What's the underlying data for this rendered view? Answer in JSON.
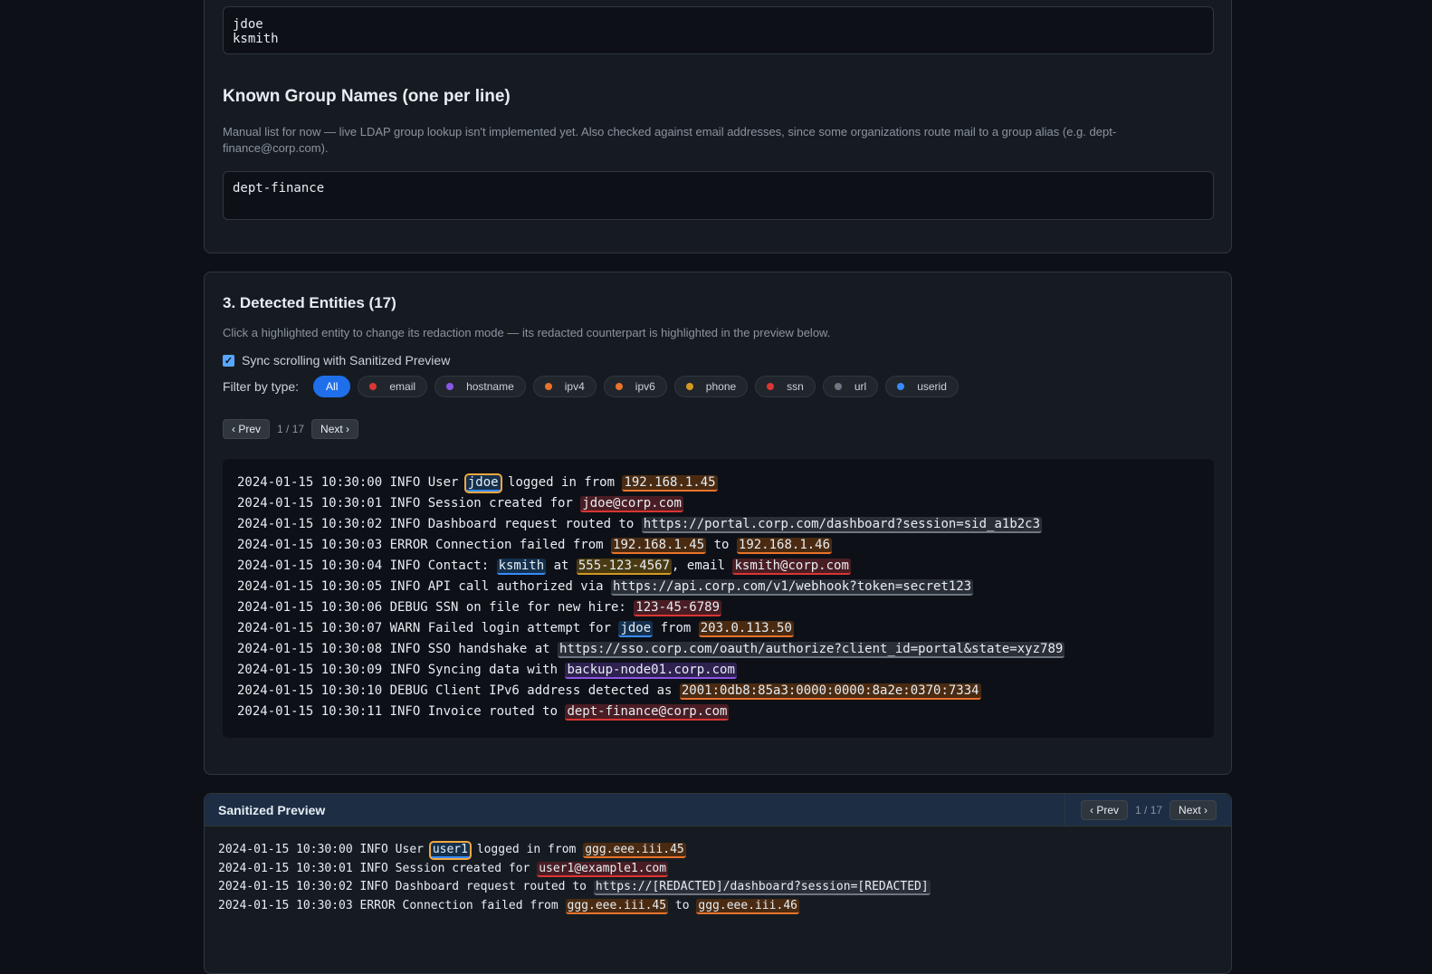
{
  "usernames": {
    "value": "jdoe\nksmith"
  },
  "groups": {
    "heading": "Known Group Names (one per line)",
    "help": "Manual list for now — live LDAP group lookup isn't implemented yet. Also checked against email addresses, since some organizations route mail to a group alias (e.g. dept-finance@corp.com).",
    "value": "dept-finance"
  },
  "entities": {
    "heading": "3. Detected Entities (17)",
    "help": "Click a highlighted entity to change its redaction mode — its redacted counterpart is highlighted in the preview below.",
    "sync_label": "Sync scrolling with Sanitized Preview",
    "sync_checked": true,
    "filter_label": "Filter by type:",
    "filters": [
      {
        "label": "All",
        "active": true
      },
      {
        "label": "email",
        "color": "#da3633"
      },
      {
        "label": "hostname",
        "color": "#8957e5"
      },
      {
        "label": "ipv4",
        "color": "#e8732a"
      },
      {
        "label": "ipv6",
        "color": "#e8732a"
      },
      {
        "label": "phone",
        "color": "#d29922"
      },
      {
        "label": "ssn",
        "color": "#da3633"
      },
      {
        "label": "url",
        "color": "#6e7681"
      },
      {
        "label": "userid",
        "color": "#388bfd"
      }
    ],
    "prev_label": "‹ Prev",
    "next_label": "Next ›",
    "counter": "1 / 17",
    "log_lines": [
      [
        {
          "t": "2024-01-15 10:30:00 INFO User "
        },
        {
          "t": "jdoe",
          "type": "userid",
          "selected": true
        },
        {
          "t": " logged in from "
        },
        {
          "t": "192.168.1.45",
          "type": "ipv4"
        }
      ],
      [
        {
          "t": "2024-01-15 10:30:01 INFO Session created for "
        },
        {
          "t": "jdoe@corp.com",
          "type": "email"
        }
      ],
      [
        {
          "t": "2024-01-15 10:30:02 INFO Dashboard request routed to "
        },
        {
          "t": "https://portal.corp.com/dashboard?session=sid_a1b2c3",
          "type": "url"
        }
      ],
      [
        {
          "t": "2024-01-15 10:30:03 ERROR Connection failed from "
        },
        {
          "t": "192.168.1.45",
          "type": "ipv4"
        },
        {
          "t": " to "
        },
        {
          "t": "192.168.1.46",
          "type": "ipv4"
        }
      ],
      [
        {
          "t": "2024-01-15 10:30:04 INFO Contact: "
        },
        {
          "t": "ksmith",
          "type": "userid"
        },
        {
          "t": " at "
        },
        {
          "t": "555-123-4567",
          "type": "phone"
        },
        {
          "t": ", email "
        },
        {
          "t": "ksmith@corp.com",
          "type": "email"
        }
      ],
      [
        {
          "t": "2024-01-15 10:30:05 INFO API call authorized via "
        },
        {
          "t": "https://api.corp.com/v1/webhook?token=secret123",
          "type": "url"
        }
      ],
      [
        {
          "t": "2024-01-15 10:30:06 DEBUG SSN on file for new hire: "
        },
        {
          "t": "123-45-6789",
          "type": "ssn"
        }
      ],
      [
        {
          "t": "2024-01-15 10:30:07 WARN Failed login attempt for "
        },
        {
          "t": "jdoe",
          "type": "userid"
        },
        {
          "t": " from "
        },
        {
          "t": "203.0.113.50",
          "type": "ipv4"
        }
      ],
      [
        {
          "t": "2024-01-15 10:30:08 INFO SSO handshake at "
        },
        {
          "t": "https://sso.corp.com/oauth/authorize?client_id=portal&state=xyz789",
          "type": "url"
        }
      ],
      [
        {
          "t": "2024-01-15 10:30:09 INFO Syncing data with "
        },
        {
          "t": "backup-node01.corp.com",
          "type": "hostname"
        }
      ],
      [
        {
          "t": "2024-01-15 10:30:10 DEBUG Client IPv6 address detected as "
        },
        {
          "t": "2001:0db8:85a3:0000:0000:8a2e:0370:7334",
          "type": "ipv6"
        }
      ],
      [
        {
          "t": "2024-01-15 10:30:11 INFO Invoice routed to "
        },
        {
          "t": "dept-finance@corp.com",
          "type": "email"
        }
      ]
    ]
  },
  "preview": {
    "title": "Sanitized Preview",
    "prev_label": "‹ Prev",
    "next_label": "Next ›",
    "counter": "1 / 17",
    "lines": [
      [
        {
          "t": "2024-01-15 10:30:00 INFO User "
        },
        {
          "t": "user1",
          "type": "userid",
          "selected": true
        },
        {
          "t": " logged in from "
        },
        {
          "t": "ggg.eee.iii.45",
          "type": "ipv4"
        }
      ],
      [
        {
          "t": "2024-01-15 10:30:01 INFO Session created for "
        },
        {
          "t": "user1@example1.com",
          "type": "email"
        }
      ],
      [
        {
          "t": "2024-01-15 10:30:02 INFO Dashboard request routed to "
        },
        {
          "t": "https://[REDACTED]/dashboard?session=[REDACTED]",
          "type": "url"
        }
      ],
      [
        {
          "t": "2024-01-15 10:30:03 ERROR Connection failed from "
        },
        {
          "t": "ggg.eee.iii.45",
          "type": "ipv4"
        },
        {
          "t": " to "
        },
        {
          "t": "ggg.eee.iii.46",
          "type": "ipv4"
        }
      ]
    ]
  }
}
